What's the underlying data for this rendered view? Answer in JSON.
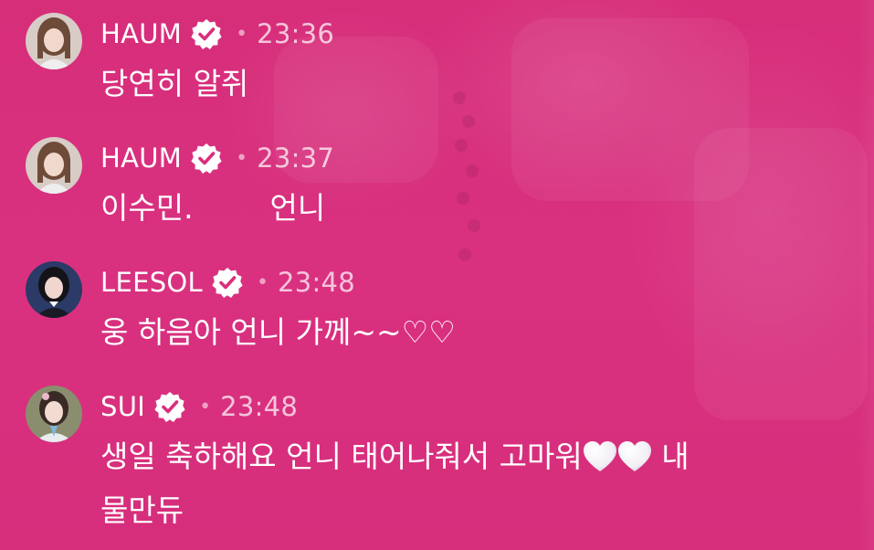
{
  "comments": [
    {
      "name": "HAUM",
      "time": "23:36",
      "text": "당연히 알쥐",
      "verified": true,
      "avatar_icon": "avatar-haum"
    },
    {
      "name": "HAUM",
      "time": "23:37",
      "text": "이수민.        언니",
      "verified": true,
      "avatar_icon": "avatar-haum"
    },
    {
      "name": "LEESOL",
      "time": "23:48",
      "text": "웅 하음아 언니 가께~~",
      "text_suffix": "♡♡",
      "verified": true,
      "avatar_icon": "avatar-leesol"
    },
    {
      "name": "SUI",
      "time": "23:48",
      "text_line1_before": "생일 축하해요 언니 태어나줘서 고마워",
      "emoji": "🤍🤍",
      "text_line1_after": " 내",
      "text_line2": "물만듀",
      "verified": true,
      "avatar_icon": "avatar-sui"
    }
  ],
  "separator": "•",
  "colors": {
    "background": "#d92f7c",
    "text": "#ffffff",
    "time": "rgba(255,255,255,0.72)"
  }
}
